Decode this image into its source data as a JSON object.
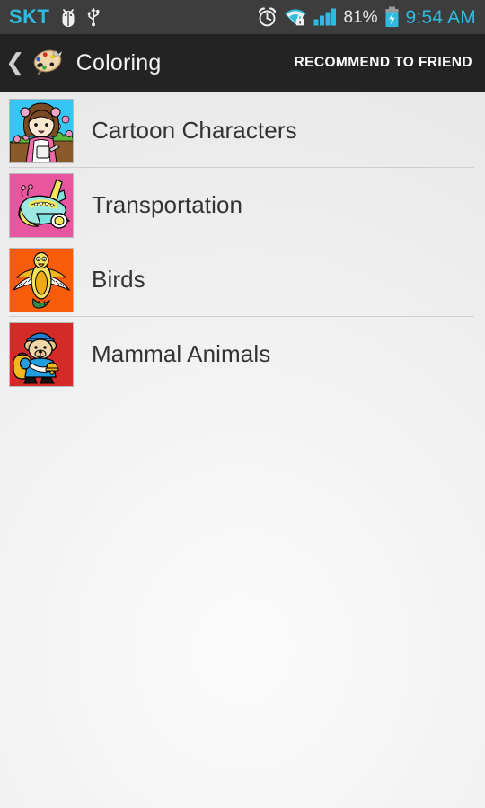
{
  "status_bar": {
    "carrier": "SKT",
    "icons": [
      "bug-icon",
      "usb-icon",
      "alarm-clock-icon",
      "wifi-secure-icon",
      "signal-bars-icon",
      "battery-charging-icon"
    ],
    "battery_percent": "81%",
    "time": "9:54 AM",
    "accent_color": "#2fbbe0",
    "background_color": "#3d3d3d"
  },
  "action_bar": {
    "back_label": "❮",
    "app_icon": "palette-icon",
    "title": "Coloring",
    "recommend_label": "RECOMMEND TO FRIEND",
    "background_color": "#232323"
  },
  "list": {
    "items": [
      {
        "label": "Cartoon Characters",
        "thumbnail": "girl-gardening-thumbnail",
        "thumb_background": "#35c6f4"
      },
      {
        "label": "Transportation",
        "thumbnail": "airplane-thumbnail",
        "thumb_background": "#e8569f"
      },
      {
        "label": "Birds",
        "thumbnail": "bird-thumbnail",
        "thumb_background": "#f95c09"
      },
      {
        "label": "Mammal Animals",
        "thumbnail": "bear-thumbnail",
        "thumb_background": "#d52b28"
      }
    ]
  },
  "page": {
    "background_color": "#eeeeee",
    "divider_color": "#cfcfcf",
    "text_color": "#333333"
  }
}
